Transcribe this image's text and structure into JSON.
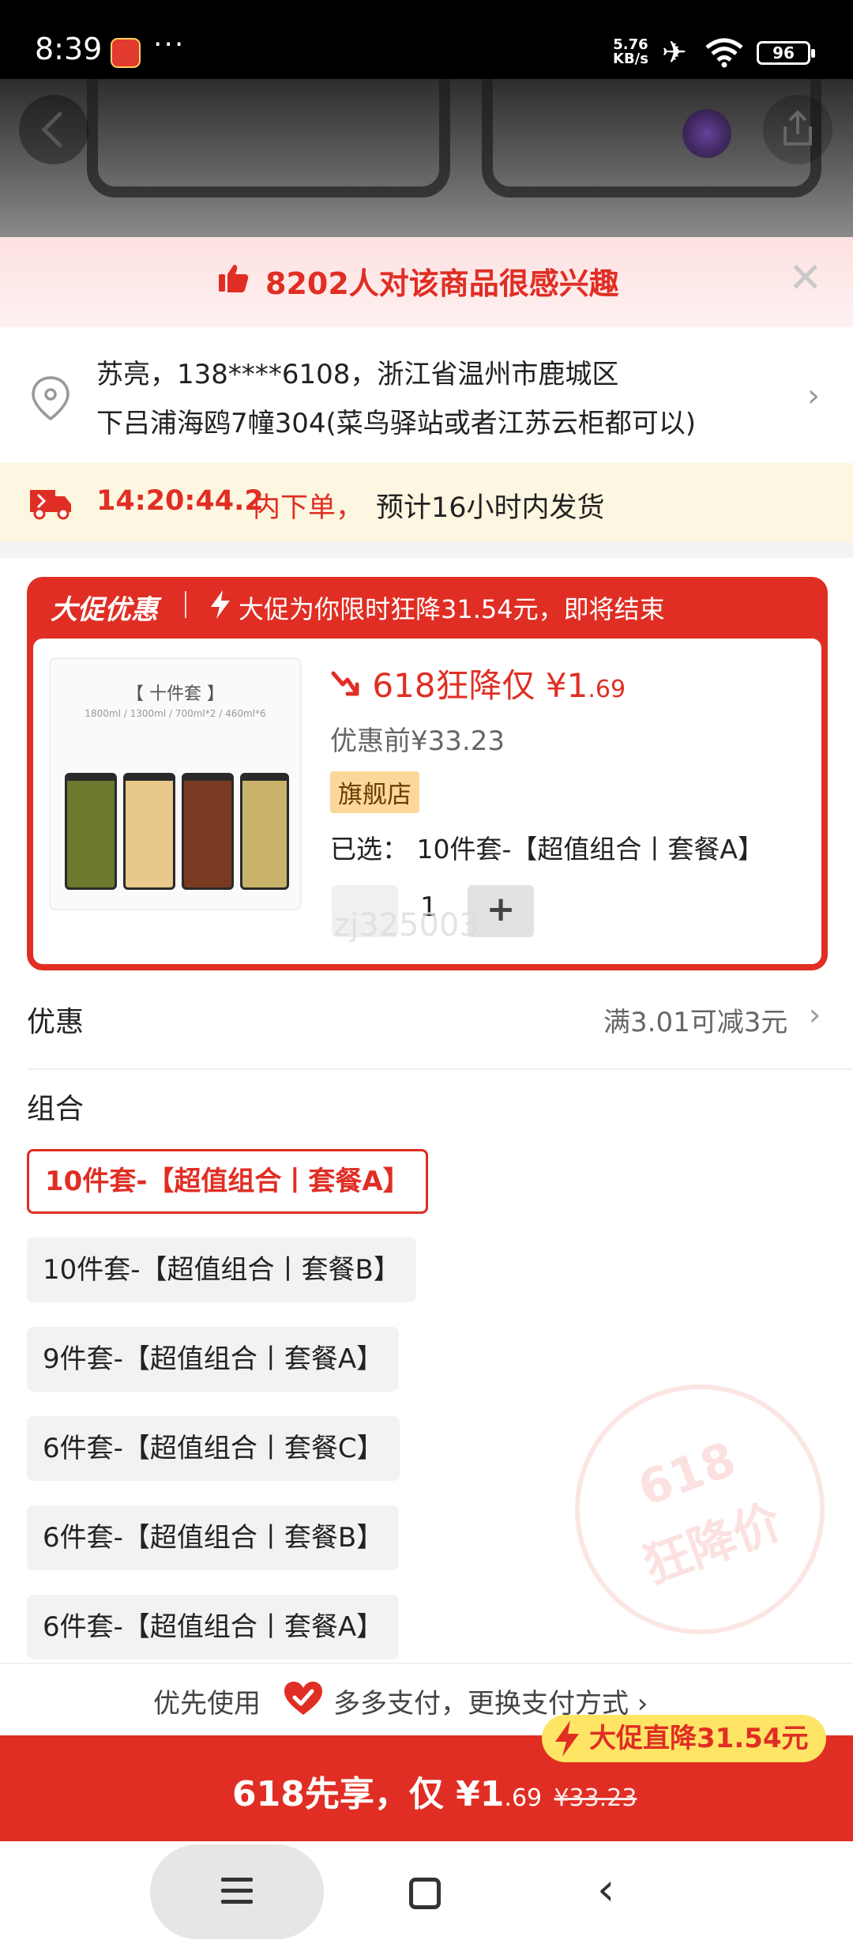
{
  "status_bar": {
    "time": "8:39",
    "dots": "···",
    "net_speed_value": "5.76",
    "net_speed_unit": "KB/s",
    "battery": "96"
  },
  "interest_banner": {
    "text": "8202人对该商品很感兴趣"
  },
  "address": {
    "line1": "苏亮，138****6108，浙江省温州市鹿城区",
    "line2": "下吕浦海鸥7幢304(菜鸟驿站或者江苏云柜都可以)"
  },
  "shipping": {
    "countdown": "14:20:44.2",
    "text_a": "内下单，",
    "text_b": "预计16小时内发货"
  },
  "promo": {
    "tag": "大促优惠",
    "headline": "大促为你限时狂降31.54元，即将结束",
    "thumb_title": "【 十件套 】",
    "thumb_sizes": "1800ml / 1300ml / 700ml*2 / 460ml*6",
    "price_label": "618狂降仅 ¥1",
    "price_cents": ".69",
    "before_price": "优惠前¥33.23",
    "store_flag": "旗舰店",
    "chosen": "已选：  10件套-【超值组合丨套餐A】",
    "quantity": "1",
    "watermark": "zj325003"
  },
  "discount": {
    "label": "优惠",
    "value": "满3.01可减3元"
  },
  "combo": {
    "label": "组合",
    "options": [
      "10件套-【超值组合丨套餐A】",
      "10件套-【超值组合丨套餐B】",
      "9件套-【超值组合丨套餐A】",
      "6件套-【超值组合丨套餐C】",
      "6件套-【超值组合丨套餐B】",
      "6件套-【超值组合丨套餐A】"
    ],
    "selected_index": 0
  },
  "stamp": {
    "line1": "618",
    "line2": "狂降价"
  },
  "payment": {
    "prefix": "优先使用",
    "method": "多多支付，更换支付方式 ›"
  },
  "cta": {
    "badge": "大促直降31.54元",
    "main": "618先享，仅 ¥1",
    "cents": ".69",
    "original": "¥33.23"
  },
  "colors": {
    "brand_red": "#e02e24",
    "badge_yellow": "#ffe566"
  }
}
